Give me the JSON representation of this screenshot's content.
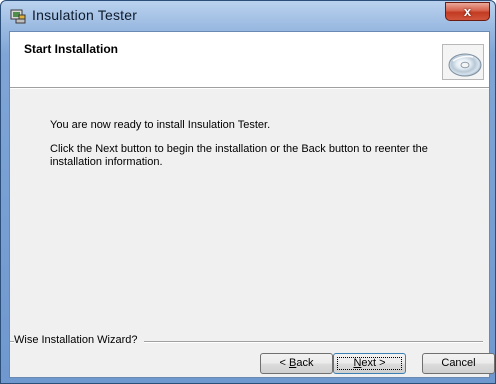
{
  "window": {
    "title": "Insulation Tester",
    "close_label": "x"
  },
  "header": {
    "title": "Start Installation"
  },
  "body": {
    "line1": "You are now ready to install Insulation Tester.",
    "line2": "Click the Next button to begin the installation or the Back button to reenter the installation information."
  },
  "footer": {
    "wizard_label": "Wise Installation Wizard?"
  },
  "buttons": {
    "back": {
      "accel": "B",
      "rest": "ack",
      "prefix": "< "
    },
    "next": {
      "accel": "N",
      "rest": "ext >"
    },
    "cancel": "Cancel"
  },
  "icons": {
    "app": "installer-app-icon",
    "header": "cd-disc-icon",
    "close": "close-icon"
  },
  "colors": {
    "title_bar": "#7fa5d6",
    "close_button": "#c23b22",
    "client_bg": "#f0f0f0",
    "focus_border": "#3c7fb1"
  }
}
